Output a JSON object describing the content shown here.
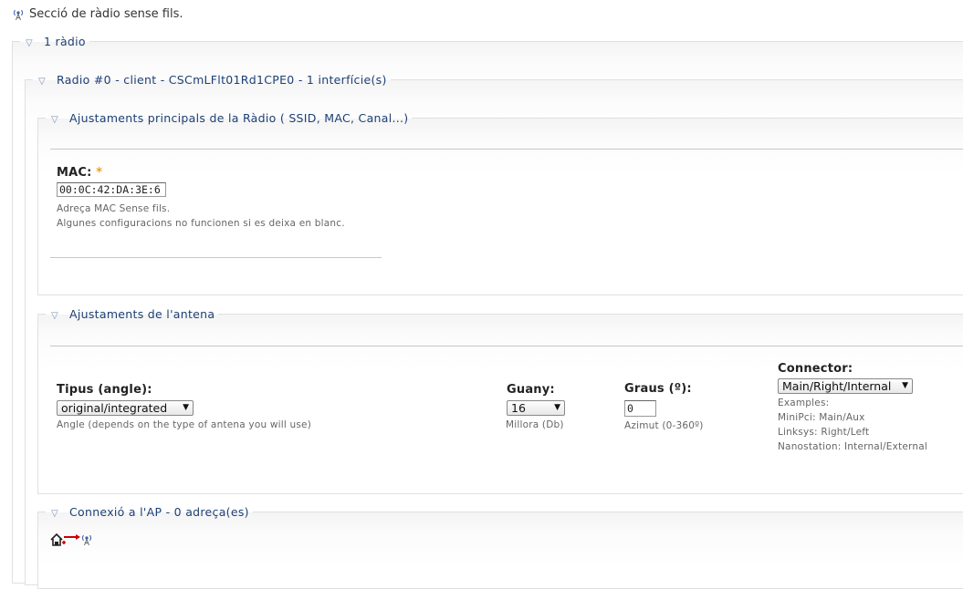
{
  "page": {
    "heading": "Secció de ràdio sense fils."
  },
  "radios_box": {
    "legend": "1 ràdio"
  },
  "radio0_box": {
    "legend": "Radio #0 - client - CSCmLFlt01Rd1CPE0 - 1 interfície(s)"
  },
  "main_settings": {
    "legend": "Ajustaments principals de la Ràdio ( SSID, MAC, Canal...)",
    "mac_label": "MAC:",
    "mac_required": "*",
    "mac_value": "00:0C:42:DA:3E:6",
    "mac_help_1": "Adreça MAC Sense fils.",
    "mac_help_2": "Algunes configuracions no funcionen si es deixa en blanc."
  },
  "antenna": {
    "legend": "Ajustaments de l'antena",
    "type_label": "Tipus (angle):",
    "type_value": "original/integrated",
    "type_help": "Angle (depends on the type of antena you will use)",
    "gain_label": "Guany:",
    "gain_value": "16",
    "gain_help": "Millora (Db)",
    "degrees_label": "Graus (º):",
    "degrees_value": "0",
    "degrees_help": "Azimut (0-360º)",
    "connector_label": "Connector:",
    "connector_value": "Main/Right/Internal",
    "connector_help_1": "Examples:",
    "connector_help_2": "MiniPci: Main/Aux",
    "connector_help_3": "Linksys: Right/Left",
    "connector_help_4": "Nanostation: Internal/External"
  },
  "ap_connection": {
    "legend": "Connexió a l'AP - 0 adreça(es)"
  },
  "icons": {
    "heading_icon": "wireless-icon",
    "add_link_icon": "add-link-icon",
    "link_arrow_icon": "arrow-right-icon",
    "link_target_icon": "wireless-icon",
    "collapse_icon": "triangle-down-icon"
  },
  "colors": {
    "legend_text": "#1c3f74",
    "required_star": "#f0a020",
    "arrow_red": "#cc0000"
  }
}
